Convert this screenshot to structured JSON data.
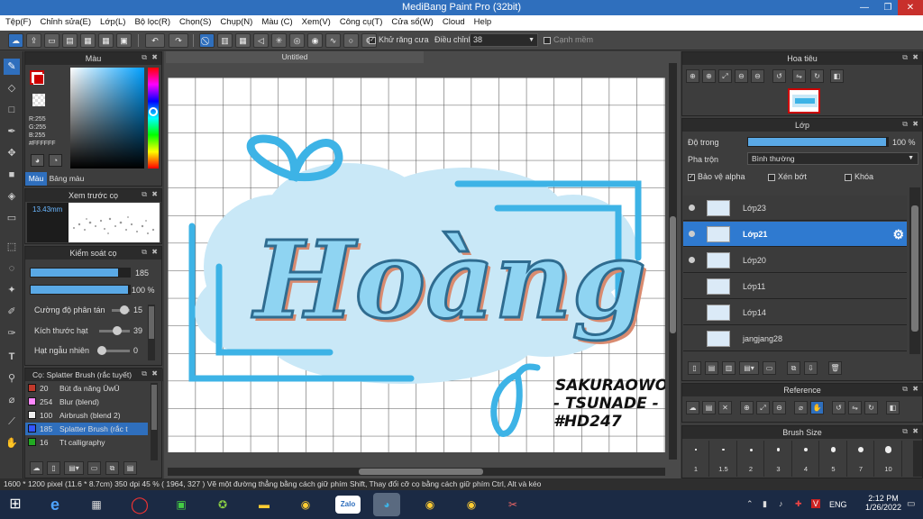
{
  "window": {
    "title": "MediBang Paint Pro (32bit)"
  },
  "menu": [
    "Tệp(F)",
    "Chỉnh sửa(E)",
    "Lớp(L)",
    "Bộ lọc(R)",
    "Chọn(S)",
    "Chụp(N)",
    "Màu (C)",
    "Xem(V)",
    "Công cụ(T)",
    "Cửa sổ(W)",
    "Cloud",
    "Help"
  ],
  "toolbar": {
    "antialias_label": "Khử răng cưa",
    "adjust_label": "Điều chỉnh",
    "adjust_value": "38",
    "smooth_label": "Cạnh mềm"
  },
  "color_panel": {
    "title": "Màu",
    "r": "R:255",
    "g": "G:255",
    "b": "B:255",
    "hex": "#FFFFFF",
    "tabs": [
      "Màu",
      "Bảng màu"
    ],
    "hue_level": 0.44
  },
  "brush_preview": {
    "title": "Xem trước cọ",
    "size": "13.43mm"
  },
  "brush_control": {
    "title": "Kiểm soát cọ",
    "size": "185",
    "opacity": "100 %",
    "size_fill": 0.9,
    "opacity_fill": 1.0,
    "scatter_label": "Cường độ phân tán",
    "scatter_value": "15",
    "scatter_level": 0.15,
    "grain_label": "Kích thước hạt",
    "grain_value": "39",
    "grain_level": 0.39,
    "random_label": "Hạt ngẫu nhiên",
    "random_value": "0",
    "random_level": 0.0
  },
  "brush_list": {
    "title": "Cọ: Splatter Brush (rắc tuyết)",
    "items": [
      {
        "size": "20",
        "name": "Bút đa năng ŪwŪ",
        "color": "#c0392b"
      },
      {
        "size": "254",
        "name": "Blur (blend)",
        "color": "#ff88ff"
      },
      {
        "size": "100",
        "name": "Airbrush (blend 2)",
        "color": "#eeeeee"
      },
      {
        "size": "185",
        "name": "Splatter Brush (rắc t",
        "color": "#3355ff"
      },
      {
        "size": "16",
        "name": "Tt calligraphy",
        "color": "#22aa22"
      }
    ]
  },
  "canvas": {
    "tab_title": "Untitled"
  },
  "artwork": {
    "main_word": "Hoàng",
    "credit_line1": "SAKURAOWO",
    "credit_line2": "- TSUNADE -",
    "credit_line3": "#HD247"
  },
  "navigator": {
    "title": "Hoa tiêu"
  },
  "layers": {
    "title": "Lớp",
    "opacity_label": "Độ trong",
    "opacity_value": "100 %",
    "opacity_level": 1.0,
    "blend_label": "Pha trộn",
    "blend_value": "Bình thường",
    "protect_alpha": "Bảo vệ alpha",
    "clipping": "Xén bớt",
    "lock": "Khóa",
    "items": [
      "Lớp23",
      "Lớp21",
      "Lớp20",
      "Lớp11",
      "Lớp14",
      "jangjang28"
    ]
  },
  "reference": {
    "title": "Reference"
  },
  "brush_size": {
    "title": "Brush Size",
    "sizes": [
      "1",
      "1.5",
      "2",
      "3",
      "4",
      "5",
      "7",
      "10"
    ]
  },
  "status": {
    "text": "1600 * 1200 pixel   (11.6 * 8.7cm)   350 dpi   45 %   ( 1964, 327 )   Vẽ một đường thẳng bằng cách giữ phím Shift, Thay đổi cỡ cọ bằng cách giữ phím Ctrl, Alt và kéo"
  },
  "taskbar": {
    "language": "ENG",
    "time": "2:12 PM",
    "date": "1/26/2022",
    "zalo": "Zalo"
  },
  "colors": {
    "accent": "#2f6fbd",
    "stroke": "#3db3e6",
    "cloud": "#c9e8f7"
  }
}
